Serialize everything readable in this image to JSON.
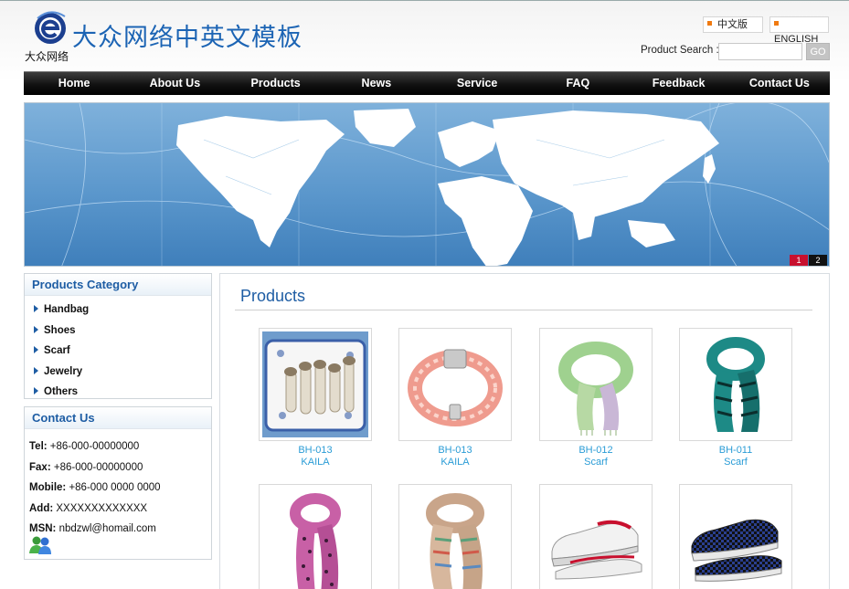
{
  "header": {
    "logo_title": "大众网络中英文模板",
    "logo_sub": "大众网络",
    "lang_cn": "中文版",
    "lang_en": "ENGLISH",
    "search_label": "Product Search :",
    "search_value": "",
    "search_go": "GO"
  },
  "nav": [
    "Home",
    "About Us",
    "Products",
    "News",
    "Service",
    "FAQ",
    "Feedback",
    "Contact Us"
  ],
  "banner": {
    "slides": [
      "1",
      "2"
    ],
    "active_slide": "1"
  },
  "sidebar": {
    "category_title": "Products Category",
    "categories": [
      "Handbag",
      "Shoes",
      "Scarf",
      "Jewelry",
      "Others"
    ],
    "contact_title": "Contact Us",
    "contact": [
      {
        "label": "Tel:",
        "value": " +86-000-00000000"
      },
      {
        "label": "Fax:",
        "value": " +86-000-00000000"
      },
      {
        "label": "Mobile:",
        "value": " +86-000 0000 0000"
      },
      {
        "label": "Add:",
        "value": " XXXXXXXXXXXXX"
      },
      {
        "label": "MSN:",
        "value": " nbdzwl@homail.com"
      }
    ]
  },
  "main": {
    "title": "Products",
    "products": [
      {
        "code": "BH-013",
        "name": "KAILA",
        "image": "mushroom-plate"
      },
      {
        "code": "BH-013",
        "name": "KAILA",
        "image": "pink-braided-bracelet"
      },
      {
        "code": "BH-012",
        "name": "Scarf",
        "image": "green-pastel-scarf"
      },
      {
        "code": "BH-011",
        "name": "Scarf",
        "image": "teal-zebra-scarf"
      },
      {
        "code": "",
        "name": "",
        "image": "pink-polka-dot-scarf"
      },
      {
        "code": "",
        "name": "",
        "image": "striped-scarf"
      },
      {
        "code": "",
        "name": "",
        "image": "white-red-sneaker"
      },
      {
        "code": "",
        "name": "",
        "image": "blue-check-sneaker"
      }
    ]
  },
  "colors": {
    "brand_blue": "#1c64b4",
    "link_blue": "#2a9cd6",
    "accent_orange": "#f07a10",
    "active_slide": "#c8102e"
  }
}
